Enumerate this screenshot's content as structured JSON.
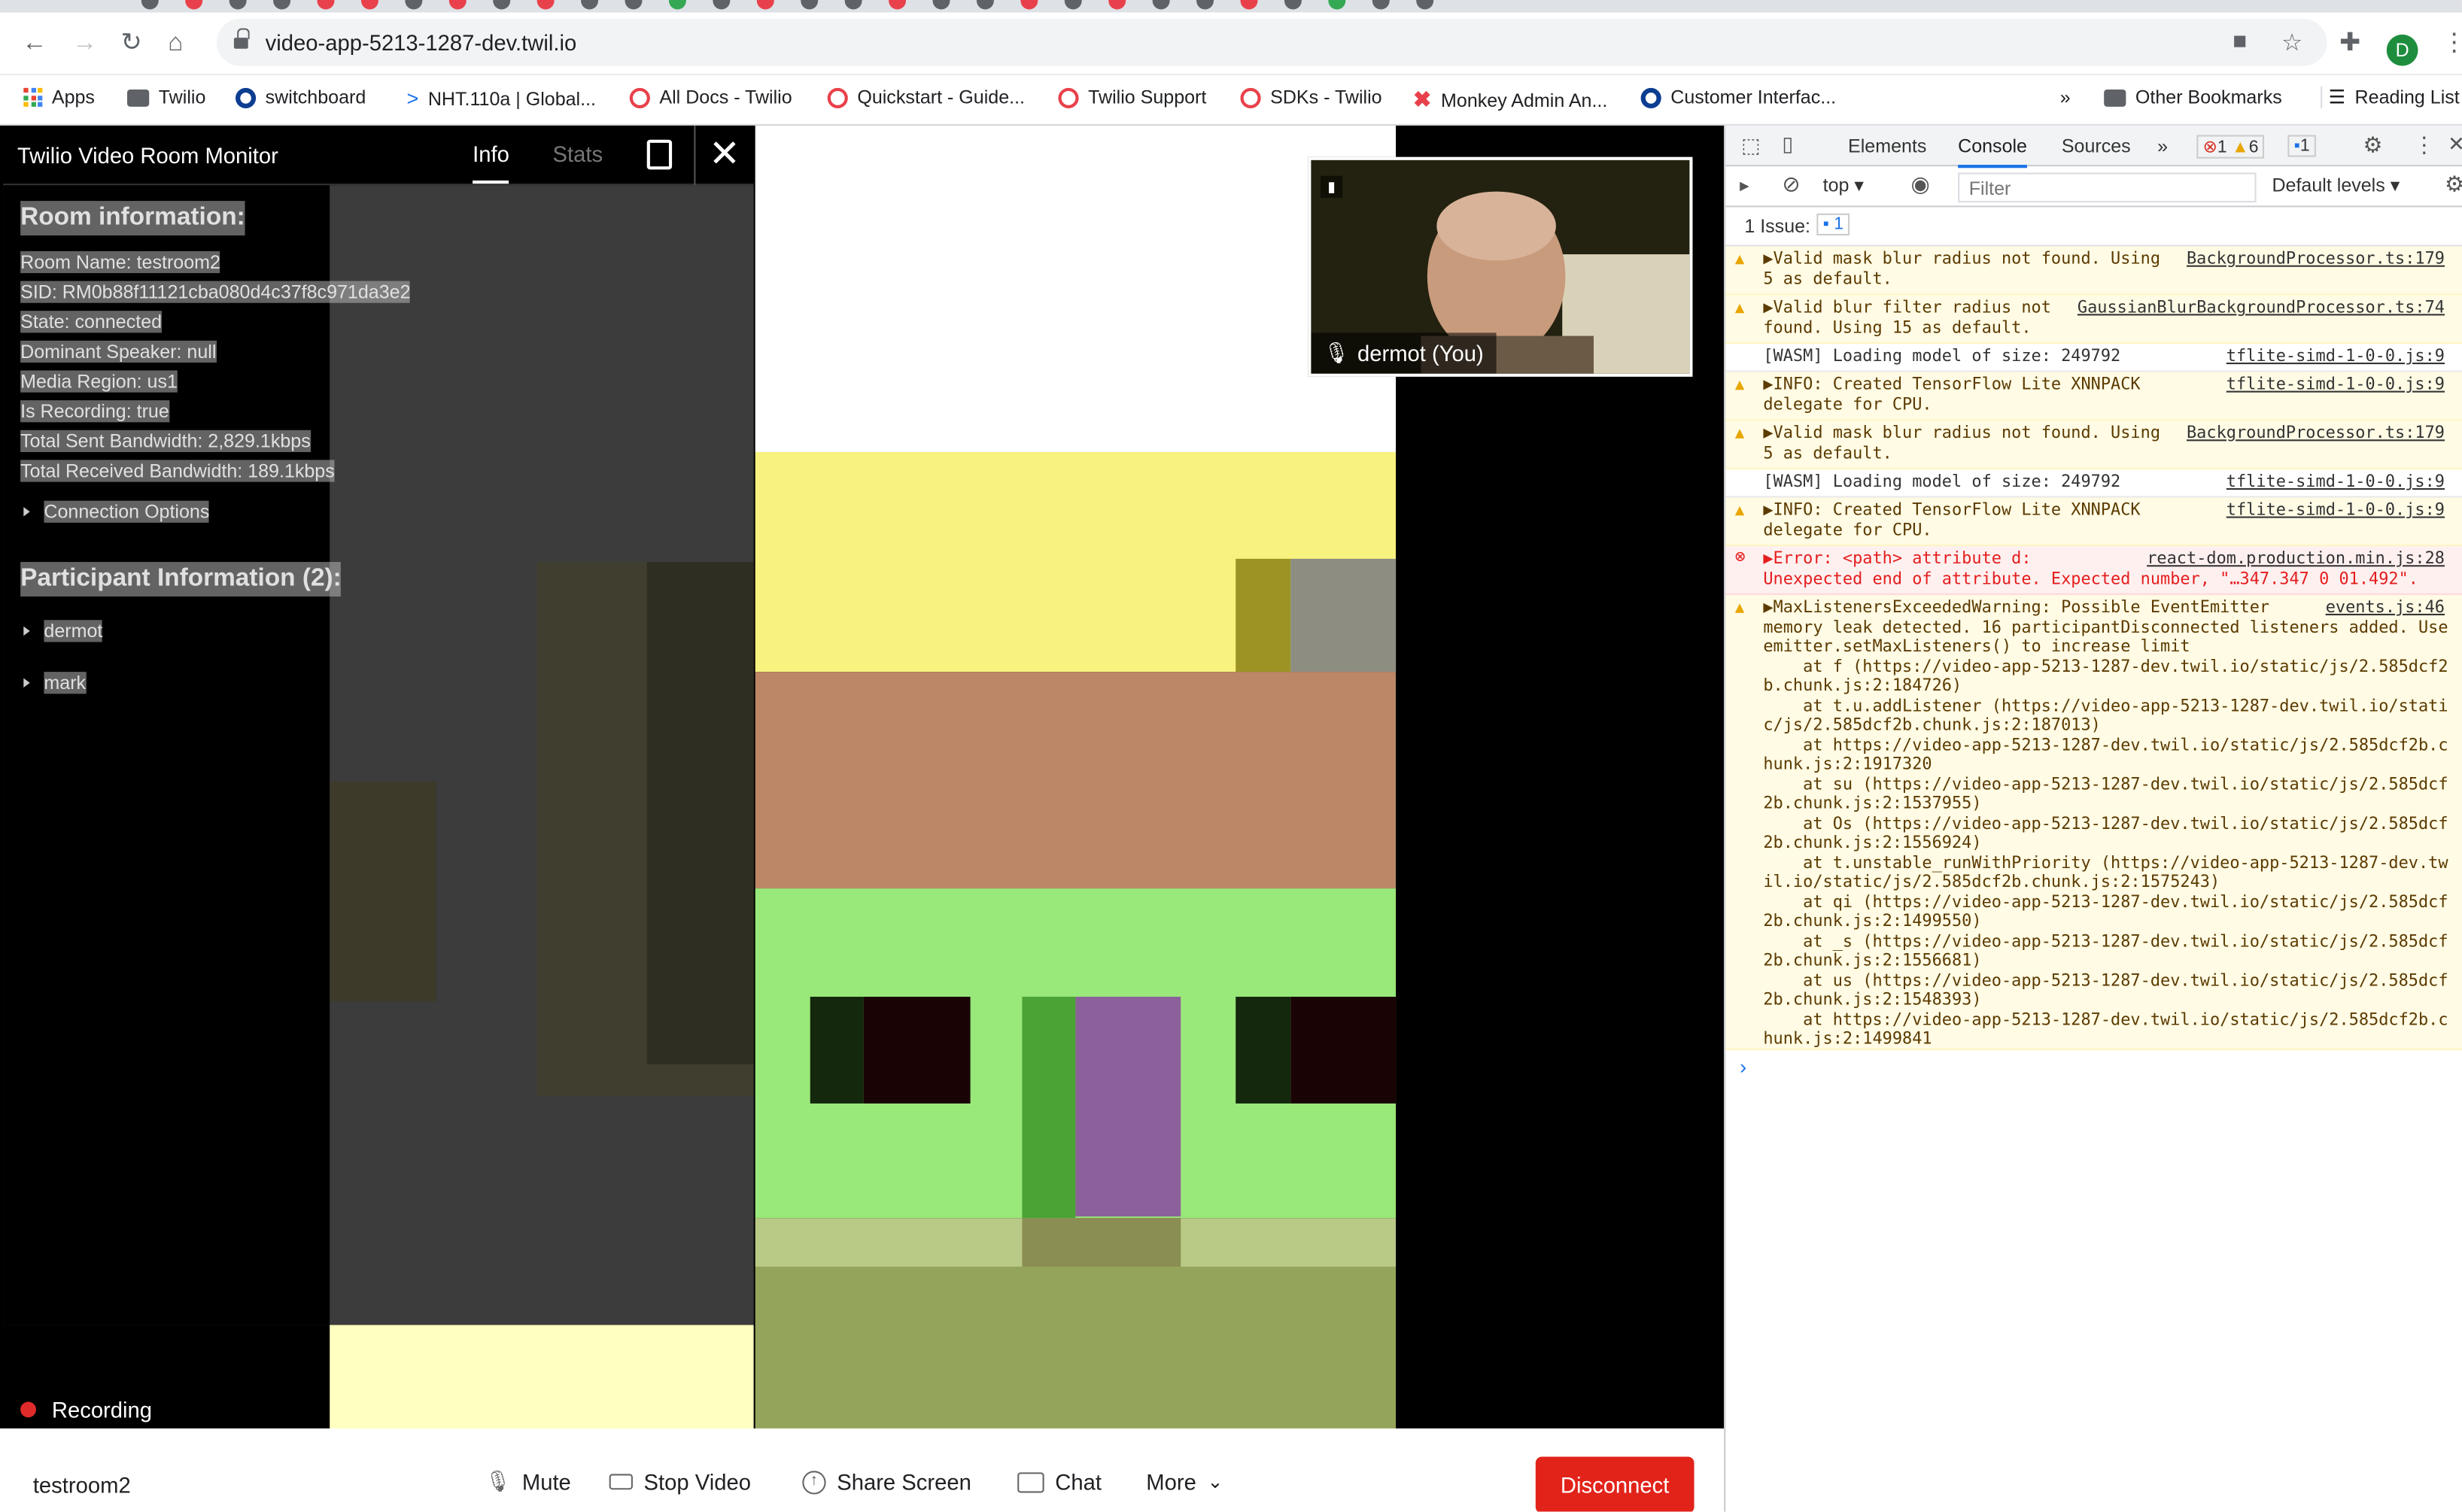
{
  "browser": {
    "url": "video-app-5213-1287-dev.twil.io",
    "profile_initial": "D",
    "bookmarks": [
      {
        "label": "Apps"
      },
      {
        "label": "Twilio"
      },
      {
        "label": "switchboard"
      },
      {
        "label": "NHT.110a | Global..."
      },
      {
        "label": "All Docs - Twilio"
      },
      {
        "label": "Quickstart - Guide..."
      },
      {
        "label": "Twilio Support"
      },
      {
        "label": "SDKs - Twilio"
      },
      {
        "label": "Monkey Admin An..."
      },
      {
        "label": "Customer Interfac..."
      }
    ],
    "more_bookmarks": "»",
    "other_bookmarks": "Other Bookmarks",
    "reading_list": "Reading List"
  },
  "monitor": {
    "title": "Twilio Video Room Monitor",
    "tab_info": "Info",
    "tab_stats": "Stats",
    "room_heading": "Room information:",
    "room_name": "Room Name: testroom2",
    "sid": "SID: RM0b88f11121cba080d4c37f8c971da3e2",
    "state": "State: connected",
    "dominant": "Dominant Speaker: null",
    "region": "Media Region: us1",
    "recording_flag": "Is Recording: true",
    "sent": "Total Sent Bandwidth: 2,829.1kbps",
    "received": "Total Received Bandwidth: 189.1kbps",
    "connection_options": "Connection Options",
    "participants_heading": "Participant Information (2):",
    "participants": [
      "dermot",
      "mark"
    ]
  },
  "video": {
    "self_label": "dermot (You)",
    "recording_label": "Recording",
    "room_label": "testroom2",
    "controls": {
      "mute": "Mute",
      "stop_video": "Stop Video",
      "share_screen": "Share Screen",
      "chat": "Chat",
      "more": "More",
      "disconnect": "Disconnect"
    },
    "colors": {
      "disconnect": "#e2231a",
      "recording_dot": "#e02b2b"
    }
  },
  "devtools": {
    "tabs": [
      "Elements",
      "Console",
      "Sources"
    ],
    "active_tab": "Console",
    "more_tabs": "»",
    "error_count": "1",
    "warning_count": "6",
    "message_count": "1",
    "context": "top",
    "filter_placeholder": "Filter",
    "levels": "Default levels",
    "issues_label": "1 Issue:",
    "issues_count": "1",
    "messages": [
      {
        "level": "warn",
        "text": "▶Valid mask blur radius not found. Using\n5 as default.",
        "source": "BackgroundProcessor.ts:179"
      },
      {
        "level": "warn",
        "text": "▶Valid blur filter radius not\nfound. Using 15 as default.",
        "source": "GaussianBlurBackgroundProcessor.ts:74"
      },
      {
        "level": "info",
        "text": "[WASM] Loading model of size: 249792",
        "source": "tflite-simd-1-0-0.js:9"
      },
      {
        "level": "warn",
        "text": "▶INFO: Created TensorFlow Lite XNNPACK\ndelegate for CPU.",
        "source": "tflite-simd-1-0-0.js:9"
      },
      {
        "level": "warn",
        "text": "▶Valid mask blur radius not found. Using\n5 as default.",
        "source": "BackgroundProcessor.ts:179"
      },
      {
        "level": "info",
        "text": "[WASM] Loading model of size: 249792",
        "source": "tflite-simd-1-0-0.js:9"
      },
      {
        "level": "warn",
        "text": "▶INFO: Created TensorFlow Lite XNNPACK\ndelegate for CPU.",
        "source": "tflite-simd-1-0-0.js:9"
      },
      {
        "level": "err",
        "text": "▶Error: <path> attribute d:\nUnexpected end of attribute. Expected number, \"…347.347 0 01.492\".",
        "source": "react-dom.production.min.js:28"
      },
      {
        "level": "warn",
        "text": "▶MaxListenersExceededWarning: Possible EventEmitter\nmemory leak detected. 16 participantDisconnected listeners added. Use\nemitter.setMaxListeners() to increase limit\n    at f (https://video-app-5213-1287-dev.twil.io/static/js/2.585dcf2\nb.chunk.js:2:184726)\n    at t.u.addListener (https://video-app-5213-1287-dev.twil.io/stati\nc/js/2.585dcf2b.chunk.js:2:187013)\n    at https://video-app-5213-1287-dev.twil.io/static/js/2.585dcf2b.c\nhunk.js:2:1917320\n    at su (https://video-app-5213-1287-dev.twil.io/static/js/2.585dcf\n2b.chunk.js:2:1537955)\n    at Os (https://video-app-5213-1287-dev.twil.io/static/js/2.585dcf\n2b.chunk.js:2:1556924)\n    at t.unstable_runWithPriority (https://video-app-5213-1287-dev.tw\nil.io/static/js/2.585dcf2b.chunk.js:2:1575243)\n    at qi (https://video-app-5213-1287-dev.twil.io/static/js/2.585dcf\n2b.chunk.js:2:1499550)\n    at _s (https://video-app-5213-1287-dev.twil.io/static/js/2.585dcf\n2b.chunk.js:2:1556681)\n    at us (https://video-app-5213-1287-dev.twil.io/static/js/2.585dcf\n2b.chunk.js:2:1548393)\n    at https://video-app-5213-1287-dev.twil.io/static/js/2.585dcf2b.c\nhunk.js:2:1499841",
        "source": "events.js:46"
      }
    ],
    "prompt_symbol": "›"
  }
}
